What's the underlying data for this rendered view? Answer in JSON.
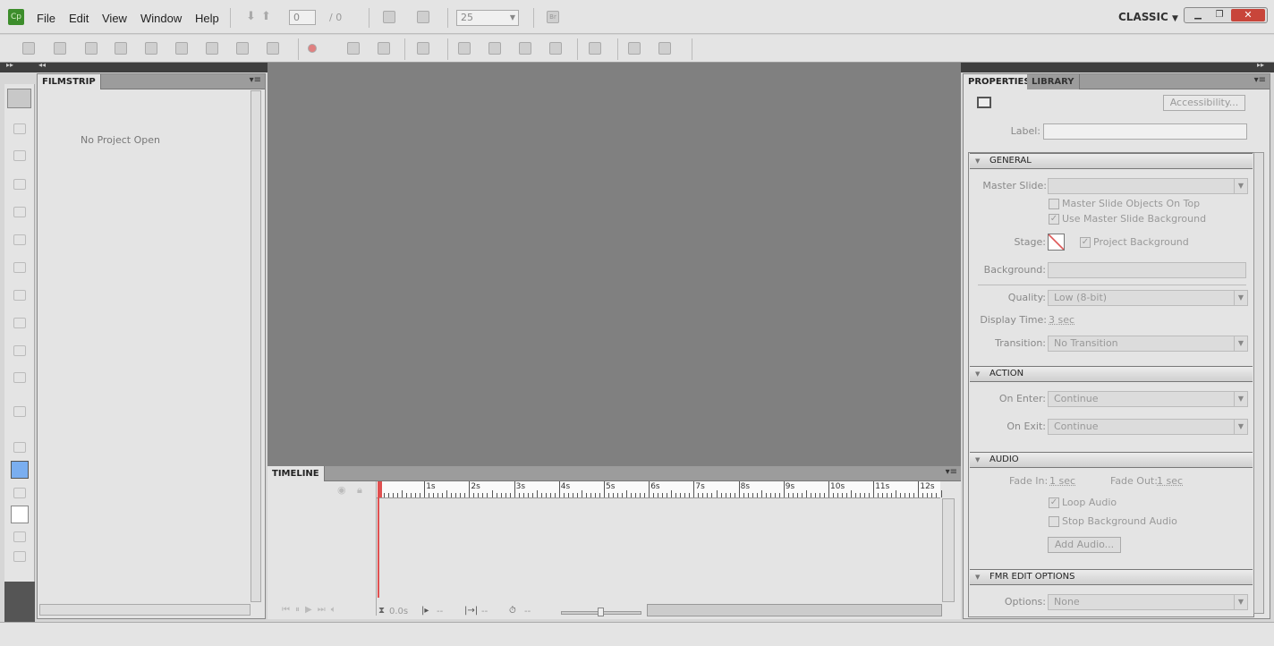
{
  "app": {
    "logo": "Cp",
    "workspace": "CLASSIC"
  },
  "menu": [
    "File",
    "Edit",
    "View",
    "Window",
    "Help"
  ],
  "nav": {
    "slide_current": "0",
    "slide_total": "/  0",
    "zoom": "25",
    "bridge": "Br"
  },
  "toolbar_icons": [
    "open-icon",
    "save-icon",
    "undo-icon",
    "redo-icon",
    "cut-icon",
    "copy-icon",
    "paste-icon",
    "duplicate-icon",
    "delete-icon",
    "record-icon",
    "audio-icon",
    "remove-audio-icon",
    "user-icon",
    "bring-forward-icon",
    "send-backward-icon",
    "bring-to-front-icon",
    "send-to-back-icon",
    "align-icon",
    "grid-icon",
    "snap-grid-icon"
  ],
  "tools": [
    "selection-tool-icon",
    "text-caption-icon",
    "rollover-caption-icon",
    "highlight-box-icon",
    "click-box-icon",
    "button-icon",
    "text-entry-icon",
    "rollover-image-icon",
    "zoom-area-icon",
    "mouse-icon",
    "text-animation-icon",
    "line-icon",
    "pencil-icon",
    "fill-color-icon",
    "paint-bucket-icon",
    "pattern-icon",
    "group-icon",
    "rotate-icon"
  ],
  "colors": {
    "fill": "#7aaef0",
    "playhead": "#e05050",
    "stage": "#808080"
  },
  "filmstrip": {
    "tab": "FILMSTRIP",
    "empty": "No Project Open"
  },
  "timeline": {
    "tab": "TIMELINE",
    "ticks": [
      "1s",
      "2s",
      "3s",
      "4s",
      "5s",
      "6s",
      "7s",
      "8s",
      "9s",
      "10s",
      "11s",
      "12s"
    ],
    "time": "0.0s",
    "start": "--",
    "end": "--",
    "duration": "--"
  },
  "properties": {
    "tabs": [
      "PROPERTIES",
      "LIBRARY"
    ],
    "accessibility": "Accessibility...",
    "label": "Label:",
    "general": {
      "title": "GENERAL",
      "master_slide": "Master Slide:",
      "master_objects_on_top": "Master Slide Objects On Top",
      "use_master_bg": "Use Master Slide Background",
      "stage": "Stage:",
      "project_bg": "Project Background",
      "background": "Background:",
      "quality_label": "Quality:",
      "quality": "Low (8-bit)",
      "display_time_label": "Display Time:",
      "display_time": "3 sec",
      "transition_label": "Transition:",
      "transition": "No Transition"
    },
    "action": {
      "title": "ACTION",
      "on_enter_label": "On Enter:",
      "on_enter": "Continue",
      "on_exit_label": "On Exit:",
      "on_exit": "Continue"
    },
    "audio": {
      "title": "AUDIO",
      "fade_in_label": "Fade In:",
      "fade_in": "1 sec",
      "fade_out_label": "Fade Out:",
      "fade_out": "1 sec",
      "loop": "Loop Audio",
      "stop_bg": "Stop Background Audio",
      "add": "Add Audio..."
    },
    "fmr": {
      "title": "FMR EDIT OPTIONS",
      "options_label": "Options:",
      "options": "None"
    }
  }
}
